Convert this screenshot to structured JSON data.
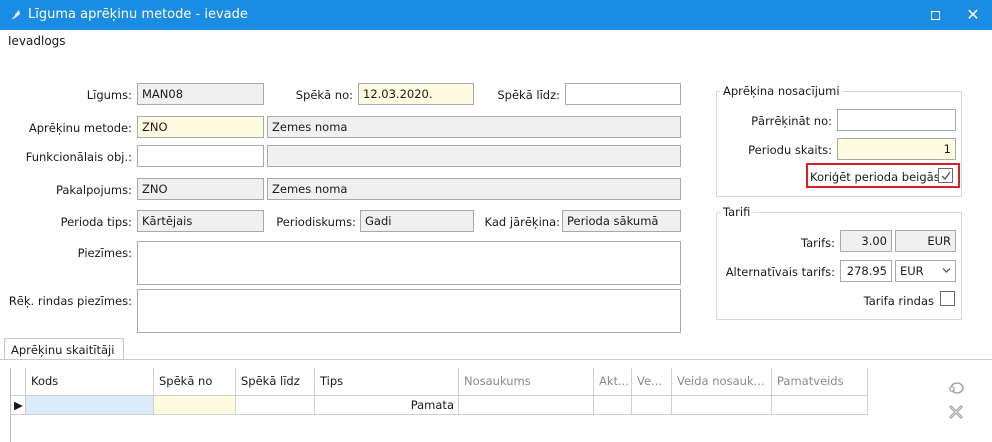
{
  "window": {
    "title": "Līguma aprēķinu metode - ievade"
  },
  "menu": {
    "ievadlogs": "Ievadlogs"
  },
  "form": {
    "ligums_label": "Līgums:",
    "ligums_value": "MAN08",
    "speka_no_label": "Spēkā no:",
    "speka_no_value": "12.03.2020.",
    "speka_lidz_label": "Spēkā līdz:",
    "speka_lidz_value": "",
    "metode_label": "Aprēķinu metode:",
    "metode_code": "ZNO",
    "metode_name": "Zemes noma",
    "funkc_label": "Funkcionālais obj.:",
    "funkc_value": "",
    "funkc_name": "",
    "pakalpojums_label": "Pakalpojums:",
    "pakalpojums_code": "ZNO",
    "pakalpojums_name": "Zemes noma",
    "perioda_tips_label": "Perioda tips:",
    "perioda_tips_value": "Kārtējais",
    "periodiskums_label": "Periodiskums:",
    "periodiskums_value": "Gadi",
    "kad_jareikina_label": "Kad jārēķina:",
    "kad_jareikina_value": "Perioda sākumā",
    "piezimes_label": "Piezīmes:",
    "piezimes_value": "",
    "rek_piezimes_label": "Rēķ. rindas piezīmes:",
    "rek_piezimes_value": ""
  },
  "conditions": {
    "group_title": "Aprēķina nosacījumi",
    "parrekinat_label": "Pārrēķināt no:",
    "parrekinat_value": "",
    "periodu_skaits_label": "Periodu skaits:",
    "periodu_skaits_value": "1",
    "koriget_label": "Koriģēt perioda beigās",
    "koriget_checked": true
  },
  "tariffs": {
    "group_title": "Tarifi",
    "tarifs_label": "Tarifs:",
    "tarifs_value": "3.00",
    "tarifs_currency": "EUR",
    "alt_label": "Alternatīvais tarifs:",
    "alt_value": "278.95",
    "alt_currency": "EUR",
    "tarifa_rindas_label": "Tarifa rindas",
    "tarifa_rindas_checked": false
  },
  "tabs": {
    "aprekinu_skaititaji": "Aprēķinu skaitītāji"
  },
  "grid": {
    "columns": [
      "Kods",
      "Spēkā no",
      "Spēkā līdz",
      "Tips",
      "Nosaukums",
      "Akt...",
      "Ve...",
      "Veida nosauk...",
      "Pamatveids"
    ],
    "rows": [
      {
        "marker": "▶",
        "kods": "",
        "speka_no": "",
        "speka_lidz": "",
        "tips": "Pamata",
        "nosaukums": "",
        "akt": "",
        "ve": "",
        "veida_nosauk": "",
        "pamatveids": ""
      }
    ]
  },
  "icons": {
    "app": "app-feather-icon",
    "maximize": "maximize-icon",
    "close": "close-icon",
    "side_add": "add-row-icon",
    "side_delete": "delete-row-icon",
    "row_indicator": "current-row-indicator-icon",
    "checkmark": "checkmark-icon",
    "dropdown": "chevron-down-icon"
  },
  "colors": {
    "titlebar": "#1b8ce3",
    "readonly_field": "#f0f0f0",
    "required_field": "#fffbe0",
    "highlight_border": "#d9202a"
  }
}
